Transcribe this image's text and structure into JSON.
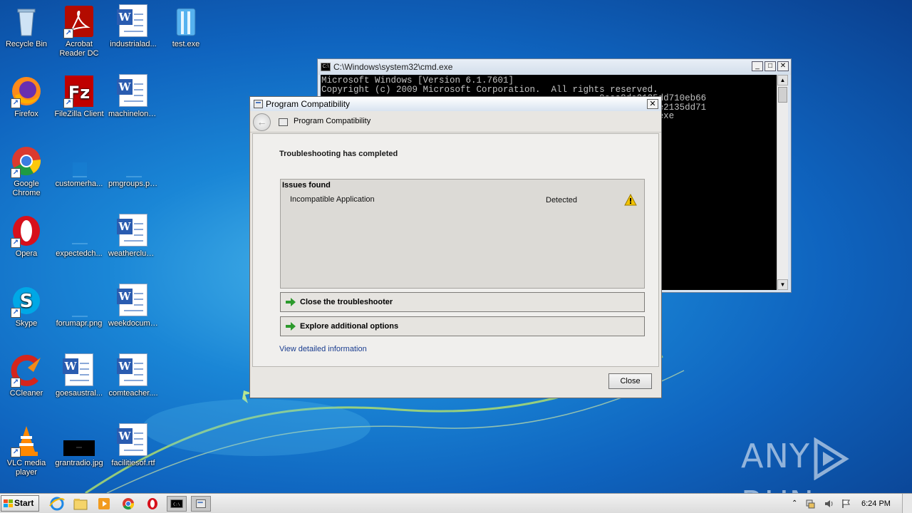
{
  "desktop": {
    "icons": [
      {
        "label": "Recycle Bin",
        "icon": "recycle-bin-icon"
      },
      {
        "label": "Acrobat Reader DC",
        "label_line1": "Acrobat",
        "label_line2": "Reader DC",
        "icon": "acrobat-icon"
      },
      {
        "label": "industrialad...",
        "icon": "word-document-icon"
      },
      {
        "label": "test.exe",
        "icon": "exe-icon"
      },
      {
        "label": "Firefox",
        "icon": "firefox-icon"
      },
      {
        "label": "FileZilla Client",
        "icon": "filezilla-icon"
      },
      {
        "label": "machinelond...",
        "icon": "word-document-icon"
      },
      {
        "label": "Google Chrome",
        "label_line1": "Google",
        "label_line2": "Chrome",
        "icon": "chrome-icon"
      },
      {
        "label": "customerha...",
        "icon": "image-file-icon"
      },
      {
        "label": "pmgroups.png",
        "icon": "image-file-icon"
      },
      {
        "label": "Opera",
        "icon": "opera-icon"
      },
      {
        "label": "expectedch...",
        "icon": "image-file-icon"
      },
      {
        "label": "weatherclub....",
        "icon": "word-document-icon"
      },
      {
        "label": "Skype",
        "icon": "skype-icon"
      },
      {
        "label": "forumapr.png",
        "icon": "image-file-icon"
      },
      {
        "label": "weekdocum....",
        "icon": "word-document-icon"
      },
      {
        "label": "CCleaner",
        "icon": "ccleaner-icon"
      },
      {
        "label": "goesaustral...",
        "icon": "word-document-icon"
      },
      {
        "label": "comteacher....",
        "icon": "word-document-icon"
      },
      {
        "label": "VLC media player",
        "label_line1": "VLC media",
        "label_line2": "player",
        "icon": "vlc-icon"
      },
      {
        "label": "grantradio.jpg",
        "icon": "image-file-icon"
      },
      {
        "label": "facilitiesof.rtf",
        "icon": "word-document-icon"
      }
    ]
  },
  "cmd": {
    "title": "C:\\Windows\\system32\\cmd.exe",
    "lines": [
      "Microsoft Windows [Version 6.1.7601]",
      "Copyright (c) 2009 Microsoft Corporation.  All rights reserved.",
      "",
      "                                                    0eaa8de2135dd710eb66",
      "",
      "                                                    2b7aa0eaa8de2135dd71",
      "                                                    sktop\\test.exe"
    ]
  },
  "dialog": {
    "title": "Program Compatibility",
    "nav_title": "Program Compatibility",
    "heading": "Troubleshooting has completed",
    "issues_header": "Issues found",
    "issues": [
      {
        "name": "Incompatible Application",
        "status": "Detected",
        "icon": "warning-icon"
      }
    ],
    "actions": [
      {
        "label": "Close the troubleshooter"
      },
      {
        "label": "Explore additional options"
      }
    ],
    "detail_link": "View detailed information",
    "close_label": "Close"
  },
  "watermark": {
    "text_left": "ANY",
    "text_right": "RUN"
  },
  "taskbar": {
    "start_label": "Start",
    "clock": "6:24 PM",
    "pinned": [
      "internet-explorer-icon",
      "explorer-icon",
      "media-player-icon",
      "chrome-icon",
      "opera-icon",
      "cmd-icon",
      "program-compatibility-icon"
    ]
  },
  "colors": {
    "desktop_blue": "#1a86d6",
    "console_bg": "#000000",
    "console_text": "#c0c0c0",
    "link": "#1a3d8f",
    "warning": "#f2c200",
    "action_arrow": "#2c9a2c"
  }
}
